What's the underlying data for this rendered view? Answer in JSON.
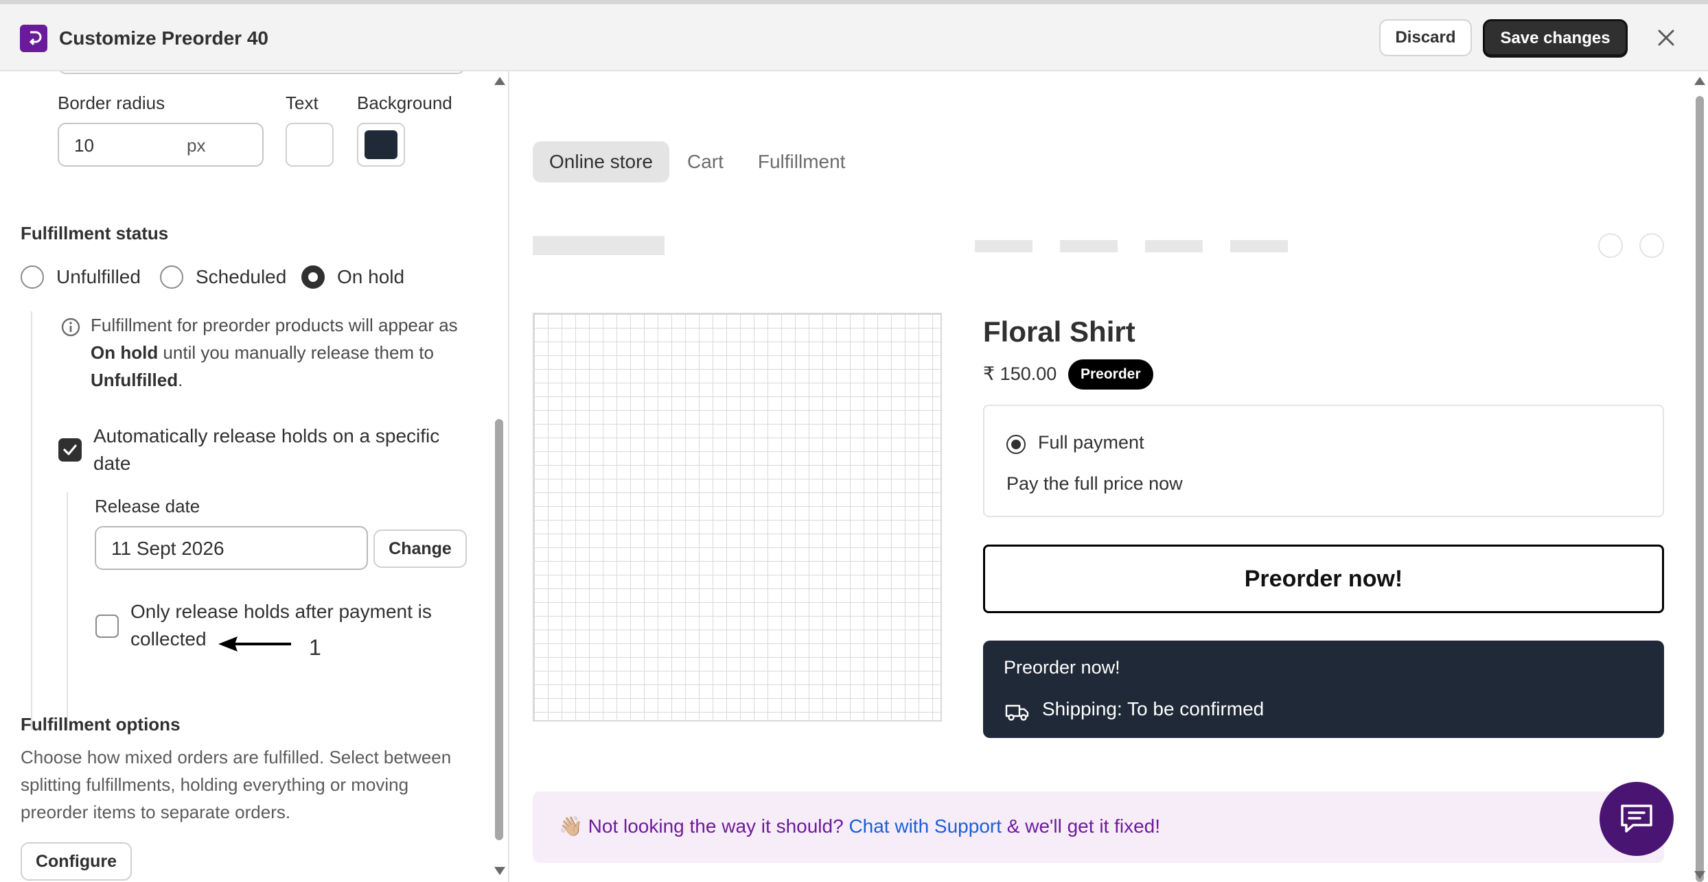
{
  "header": {
    "title": "Customize Preorder 40",
    "discard_label": "Discard",
    "save_label": "Save changes"
  },
  "left_panel": {
    "border_radius": {
      "label": "Border radius",
      "value": "10",
      "unit": "px"
    },
    "text_color": {
      "label": "Text",
      "color": "#ffffff"
    },
    "background_color": {
      "label": "Background",
      "color": "#1f2937"
    },
    "fulfillment_status": {
      "title": "Fulfillment status",
      "options": [
        {
          "label": "Unfulfilled",
          "selected": false
        },
        {
          "label": "Scheduled",
          "selected": false
        },
        {
          "label": "On hold",
          "selected": true
        }
      ],
      "info": {
        "part1": "Fulfillment for preorder products will appear as ",
        "bold1": "On hold",
        "part2": " until you manually release them to ",
        "bold2": "Unfulfilled",
        "part3": "."
      }
    },
    "auto_release": {
      "label": "Automatically release holds on a specific date",
      "checked": true,
      "release_date_label": "Release date",
      "release_date_value": "11 Sept 2026",
      "change_label": "Change",
      "only_after_payment_label": "Only release holds after payment is collected",
      "only_after_payment_checked": false
    },
    "annotation": "1",
    "fulfillment_options": {
      "title": "Fulfillment options",
      "description": "Choose how mixed orders are fulfilled. Select between splitting fulfillments, holding everything or moving preorder items to separate orders.",
      "configure_label": "Configure"
    }
  },
  "preview": {
    "tabs": [
      {
        "label": "Online store",
        "active": true
      },
      {
        "label": "Cart",
        "active": false
      },
      {
        "label": "Fulfillment",
        "active": false
      }
    ],
    "product": {
      "title": "Floral Shirt",
      "price": "₹ 150.00",
      "badge": "Preorder",
      "payment_option": "Full payment",
      "payment_subtext": "Pay the full price now",
      "preorder_button": "Preorder now!",
      "dark_box_title": "Preorder now!",
      "shipping_text": "Shipping: To be confirmed"
    },
    "support": {
      "emoji": "👋🏼",
      "text_before": "Not looking the way it should? ",
      "link": "Chat with Support",
      "text_after": " & we'll get it fixed!"
    }
  },
  "icons": {
    "app_logo": "app-logo-icon",
    "close": "close-icon",
    "info": "info-icon",
    "check": "check-icon",
    "truck": "truck-icon",
    "chat": "chat-icon"
  },
  "colors": {
    "brand": "#6a1b9a",
    "dark_button": "#303030",
    "preview_dark": "#1f2937",
    "support_bg": "#f6edf9",
    "support_text": "#6d1a9a",
    "link": "#1a5fd6",
    "chat_fab": "#4a1572"
  }
}
